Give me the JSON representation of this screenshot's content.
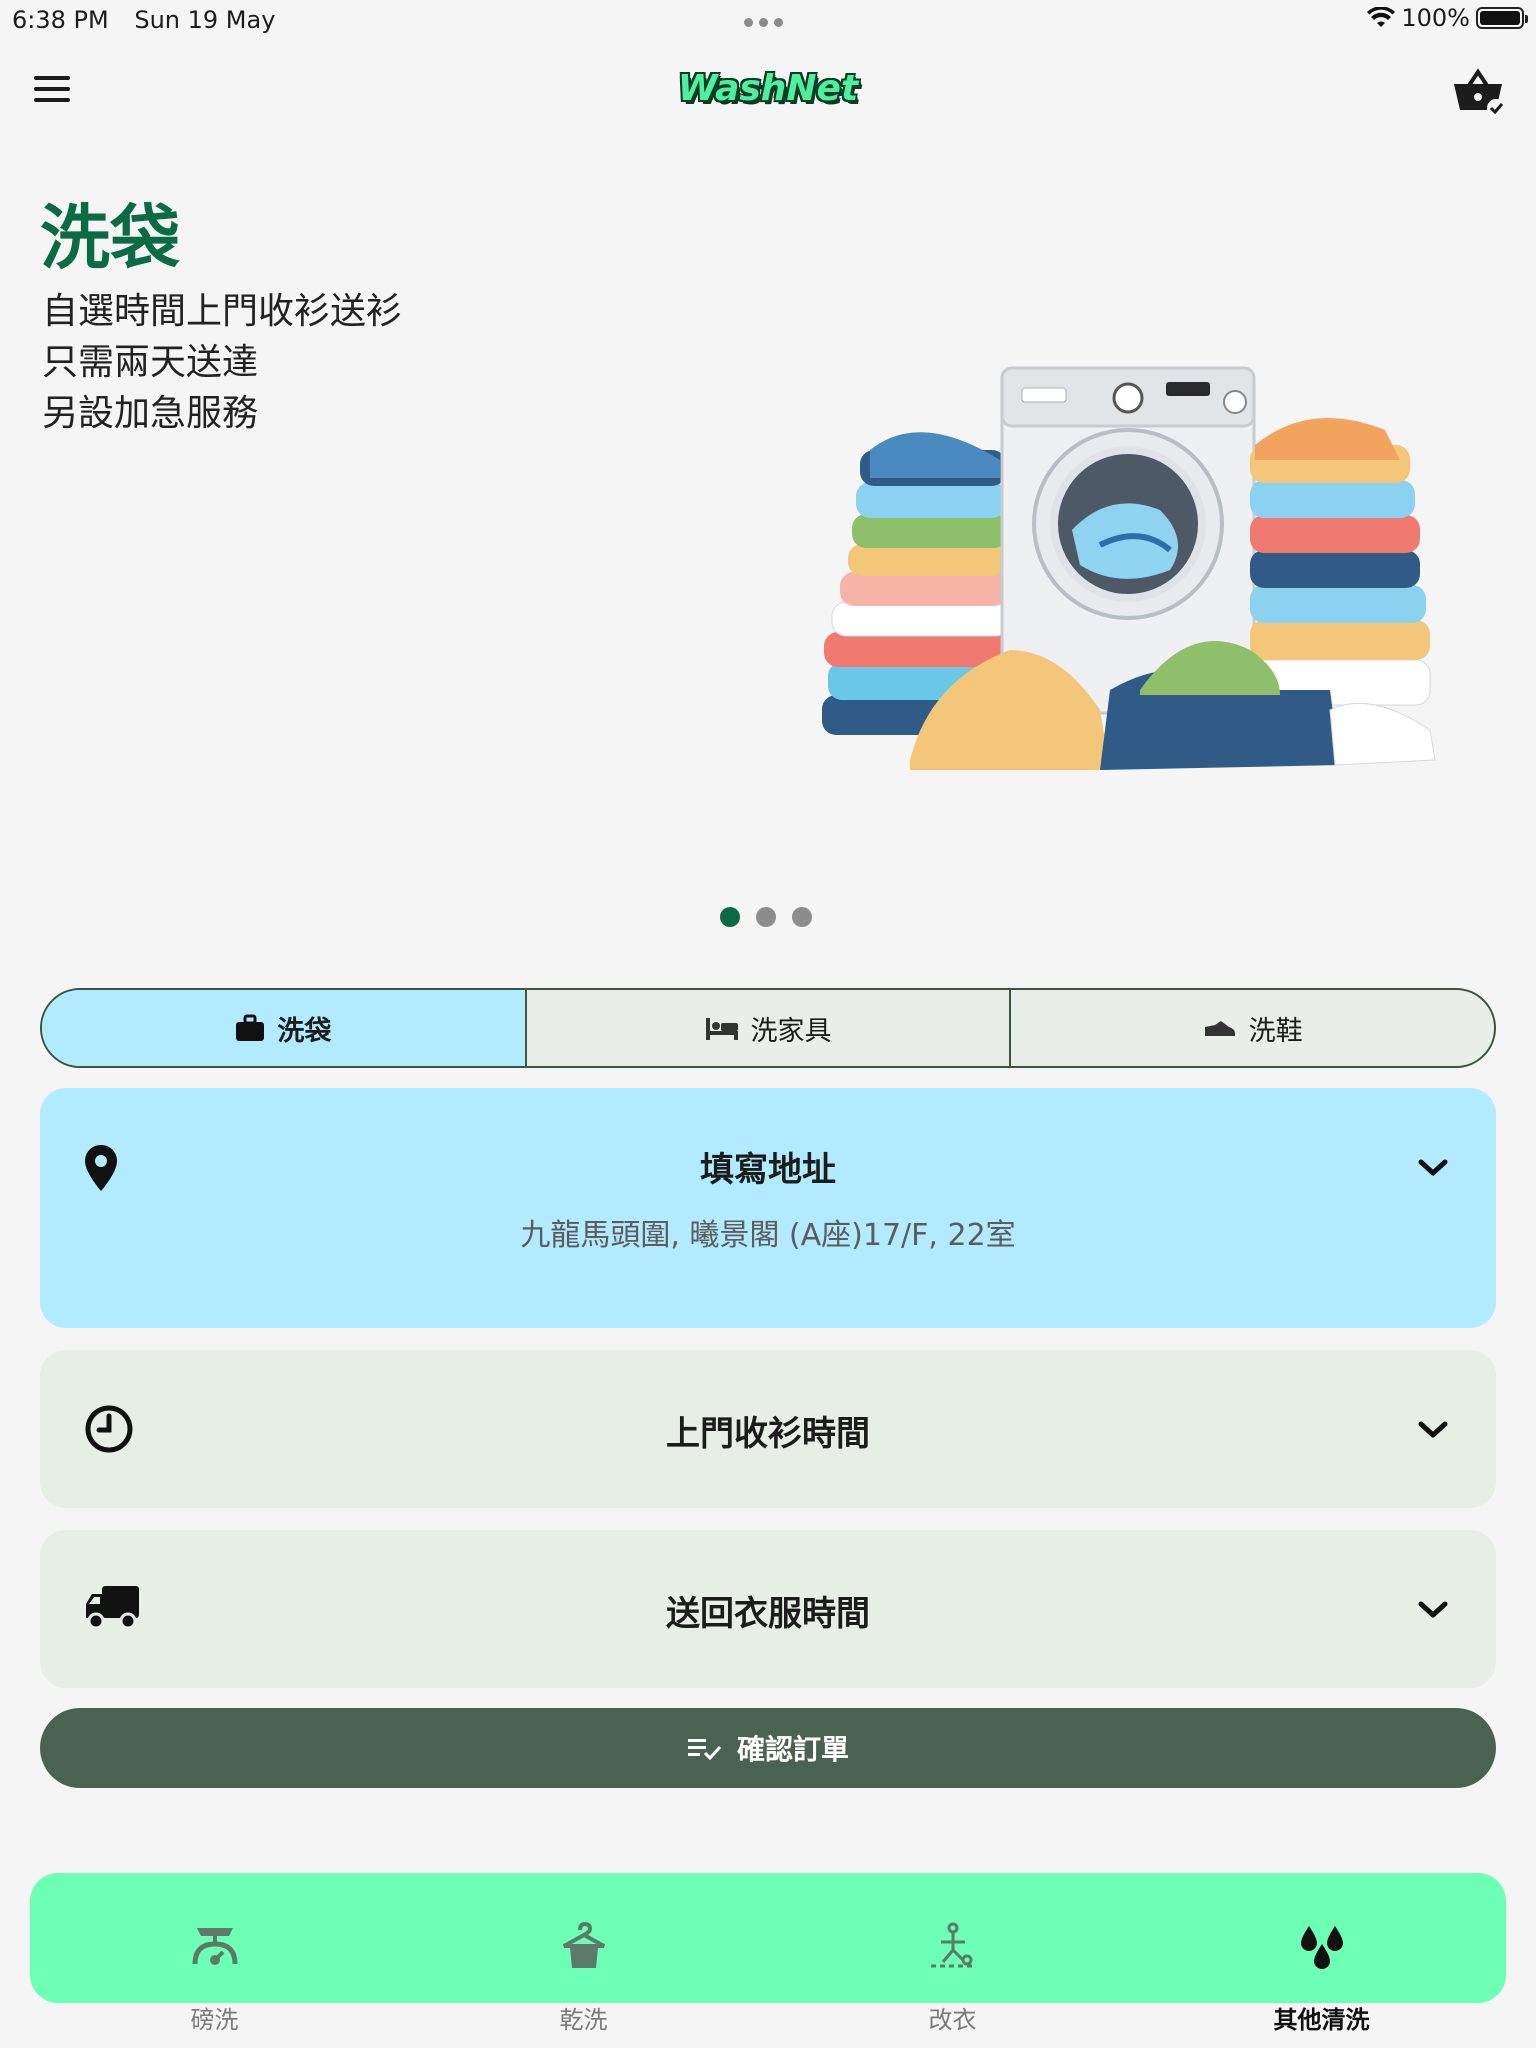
{
  "status_bar": {
    "time": "6:38 PM",
    "date": "Sun 19 May",
    "battery": "100%",
    "battery_level": 1.0
  },
  "header": {
    "brand": "WashNet",
    "menu_icon": "hamburger-menu-icon",
    "basket_icon": "basket-check-icon",
    "brand_color": "#4ef0a0"
  },
  "hero": {
    "title": "洗袋",
    "lines": [
      "自選時間上門收衫送衫",
      "只需兩天送達",
      "另設加急服務"
    ],
    "title_color": "#0b6b44",
    "slides_total": 3,
    "slide_active": 1
  },
  "tabs": [
    {
      "label": "洗袋",
      "icon": "bag-icon",
      "active": true
    },
    {
      "label": "洗家具",
      "icon": "bed-icon",
      "active": false
    },
    {
      "label": "洗鞋",
      "icon": "shoe-icon",
      "active": false
    }
  ],
  "address_card": {
    "title": "填寫地址",
    "value": "九龍馬頭圍, 曦景閣 (A座)17/F, 22室",
    "icon": "location-pin-icon",
    "color": "#b2ebff"
  },
  "pickup_card": {
    "title": "上門收衫時間",
    "icon": "clock-icon"
  },
  "delivery_card": {
    "title": "送回衣服時間",
    "icon": "truck-icon"
  },
  "confirm": {
    "label": "確認訂單",
    "icon": "checklist-icon",
    "color": "#4a6350"
  },
  "bottom_nav": {
    "items": [
      {
        "label": "磅洗",
        "icon": "scale-icon",
        "active": false
      },
      {
        "label": "乾洗",
        "icon": "hanger-shirt-icon",
        "active": false
      },
      {
        "label": "改衣",
        "icon": "sewing-icon",
        "active": false
      },
      {
        "label": "其他清洗",
        "icon": "water-drops-icon",
        "active": true
      }
    ],
    "color": "#6dffb5"
  }
}
